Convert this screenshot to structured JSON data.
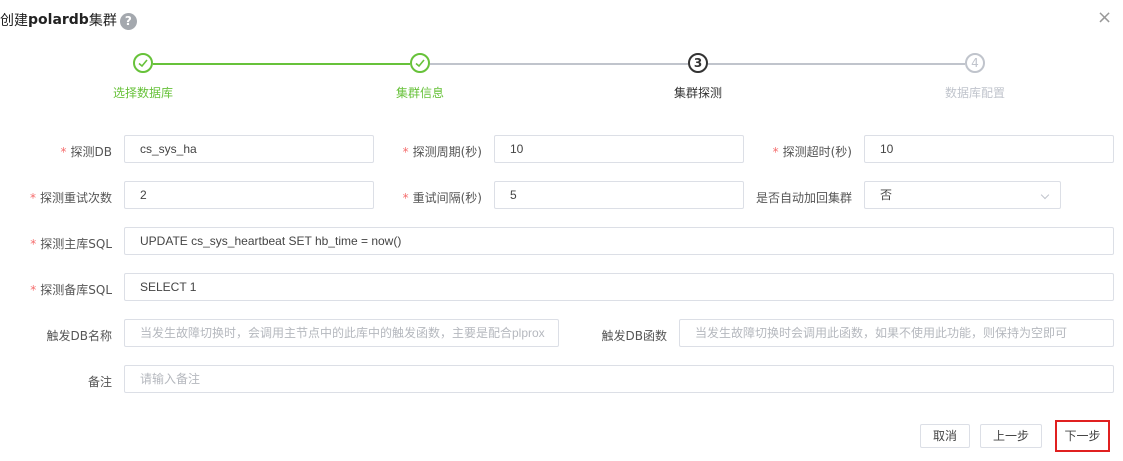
{
  "dialog": {
    "title_prefix": "创建",
    "title_strong": "polardb",
    "title_suffix": "集群",
    "help_glyph": "?",
    "close_glyph": "×"
  },
  "steps": [
    {
      "label": "选择数据库",
      "status": "done"
    },
    {
      "label": "集群信息",
      "status": "done"
    },
    {
      "label": "集群探测",
      "status": "current",
      "number": "3"
    },
    {
      "label": "数据库配置",
      "status": "wait",
      "number": "4"
    }
  ],
  "form": {
    "probe_db": {
      "label": "探测DB",
      "value": "cs_sys_ha"
    },
    "probe_period": {
      "label": "探测周期(秒)",
      "value": "10"
    },
    "probe_timeout": {
      "label": "探测超时(秒)",
      "value": "10"
    },
    "probe_retries": {
      "label": "探测重试次数",
      "value": "2"
    },
    "retry_interval": {
      "label": "重试间隔(秒)",
      "value": "5"
    },
    "auto_rejoin": {
      "label": "是否自动加回集群",
      "value": "否"
    },
    "master_sql": {
      "label": "探测主库SQL",
      "value": "UPDATE cs_sys_heartbeat SET hb_time = now()"
    },
    "standby_sql": {
      "label": "探测备库SQL",
      "value": "SELECT 1"
    },
    "trigger_db_name": {
      "label": "触发DB名称",
      "placeholder": "当发生故障切换时，会调用主节点中的此库中的触发函数，主要是配合plprox"
    },
    "trigger_db_func": {
      "label": "触发DB函数",
      "placeholder": "当发生故障切换时会调用此函数，如果不使用此功能，则保持为空即可"
    },
    "remark": {
      "label": "备注",
      "placeholder": "请输入备注"
    }
  },
  "buttons": {
    "cancel": "取消",
    "prev": "上一步",
    "next": "下一步"
  },
  "colors": {
    "done": "#67c23a",
    "required": "#f56c6c",
    "highlight": "#e02020"
  }
}
